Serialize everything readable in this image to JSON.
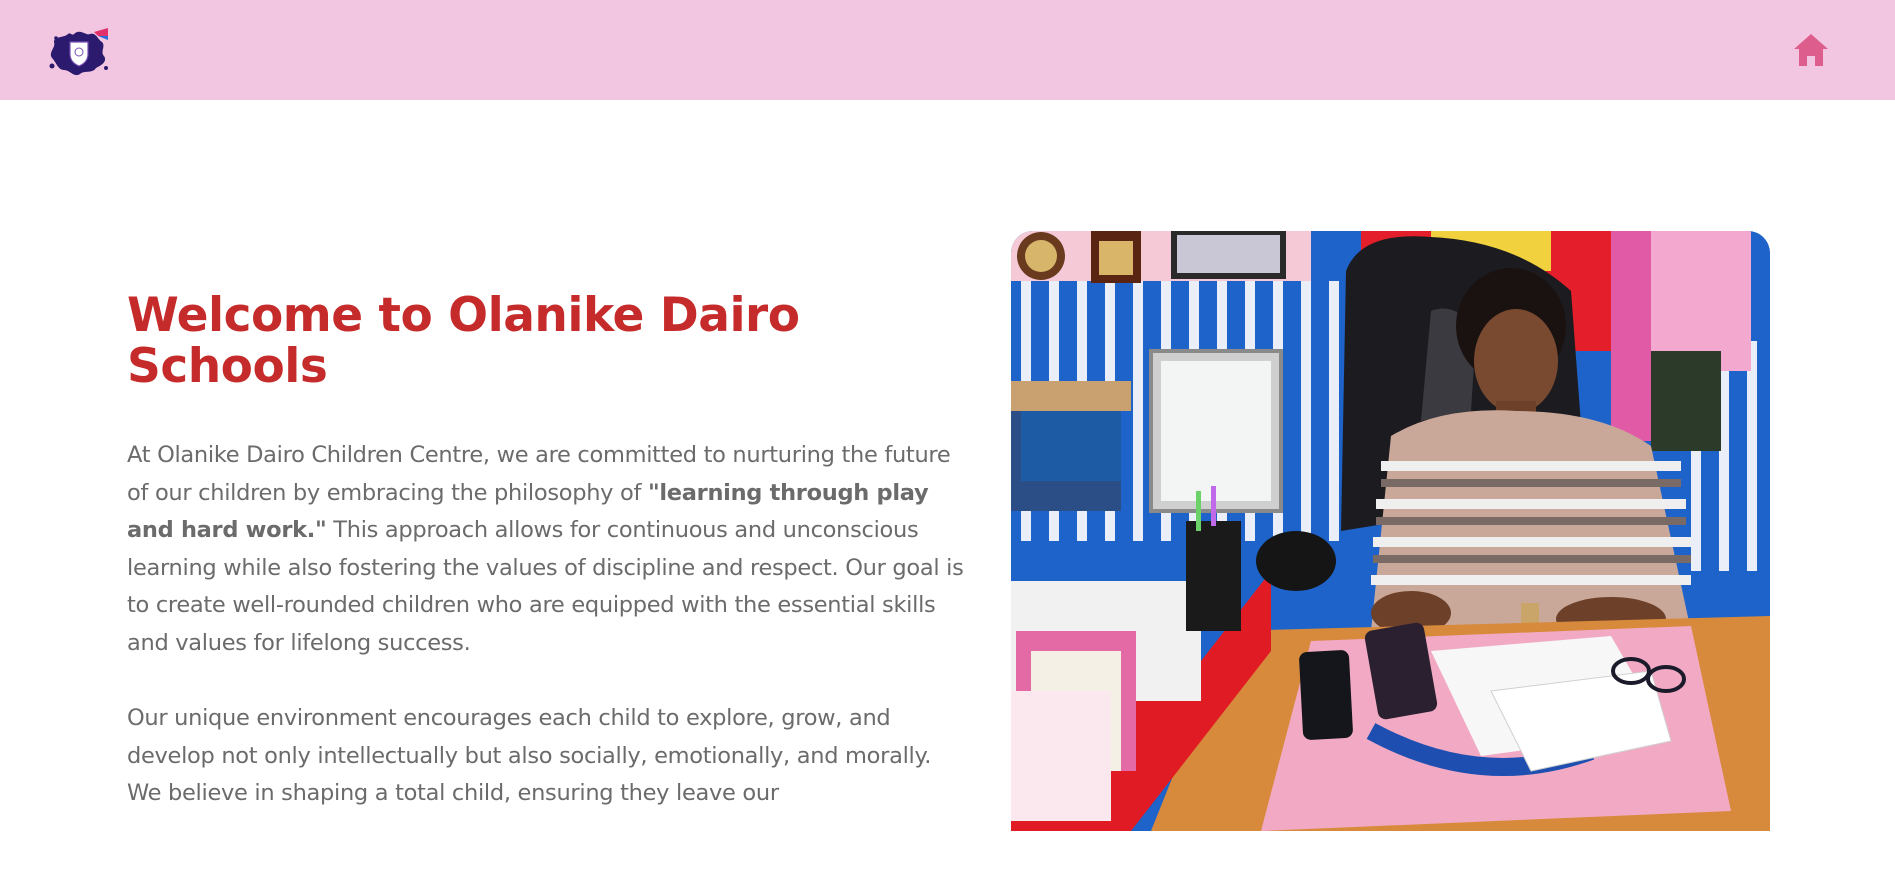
{
  "header": {
    "logo_icon": "school-crest-logo",
    "home_icon": "home-icon",
    "background": "#f2c6e0",
    "home_icon_color": "#dd5e8c"
  },
  "hero": {
    "title": "Welcome to Olanike Dairo Schools",
    "title_color": "#c62b2b",
    "paragraph_1": {
      "before_bold": "At Olanike Dairo Children Centre, we are committed to nurturing the future of our children by embracing the philosophy of ",
      "bold": "\"learning through play and hard work.\"",
      "after_bold": " This approach allows for continuous and unconscious learning while also fostering the values of discipline and respect. Our goal is to create well-rounded children who are equipped with the essential skills and values for lifelong success."
    },
    "paragraph_2": "Our unique environment encourages each child to explore, grow, and develop not only intellectually but also socially, emotionally, and morally. We believe in shaping a total child, ensuring they leave our",
    "photo_icon": "director-at-desk-photo"
  }
}
